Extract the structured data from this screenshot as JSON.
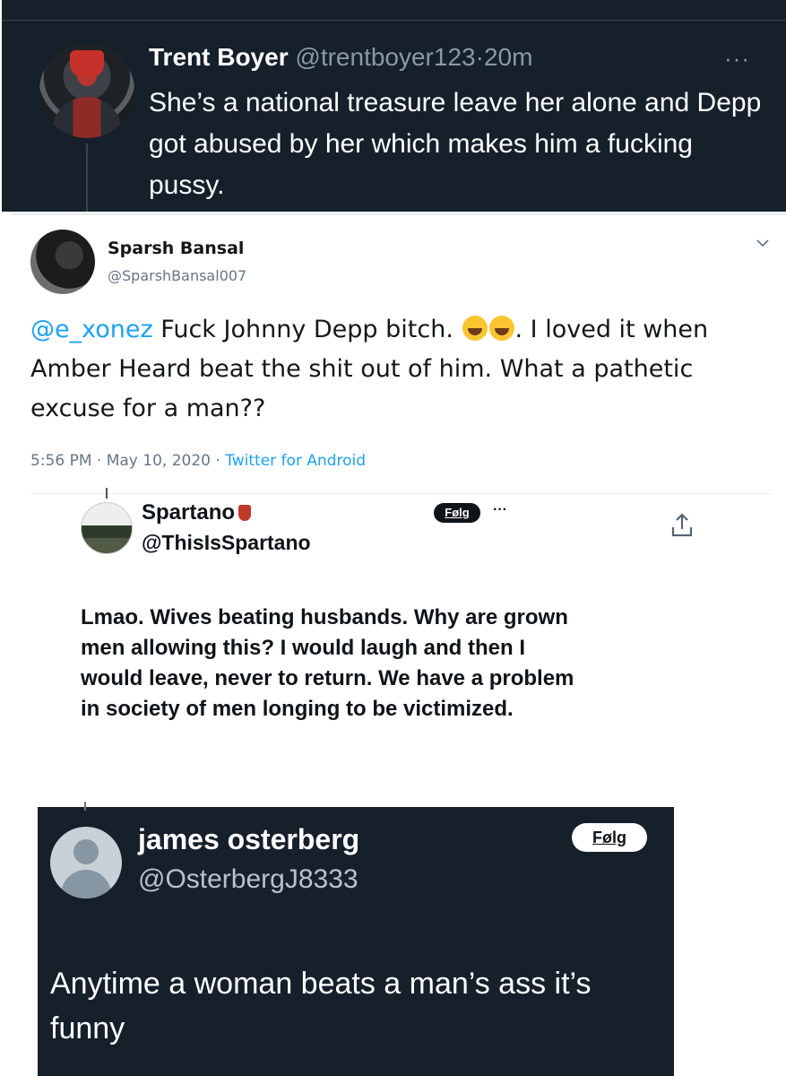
{
  "tweets": [
    {
      "name": "Trent Boyer",
      "handle": "@trentboyer123",
      "dot": "·",
      "time": "20m",
      "more": "···",
      "text": "She’s a national treasure leave her alone and Depp got abused by her which makes him a fucking pussy.",
      "colors": {
        "background": "#15202b",
        "text": "#ffffff",
        "muted": "#8b98a5"
      }
    },
    {
      "name": "Sparsh Bansal",
      "handle": "@SparshBansal007",
      "mention": "@e_xonez",
      "text_before_emoji": "Fuck Johnny Depp bitch.",
      "emojis": [
        "face-with-tears-of-joy-icon",
        "face-with-tears-of-joy-icon"
      ],
      "text_after_emoji": ". I loved it when Amber Heard beat the shit out of him. What a pathetic excuse for a man??",
      "timestamp": "5:56 PM · May 10, 2020 ·",
      "source": "Twitter for Android",
      "menu_icon": "chevron-down-icon",
      "colors": {
        "background": "#ffffff",
        "text": "#14171a",
        "link": "#1da1f2",
        "muted": "#657786"
      }
    },
    {
      "name": "Spartano",
      "handle": "@ThisIsSpartano",
      "follow_label": "Følg",
      "more": "···",
      "share_icon": "share-icon",
      "text": "Lmao. Wives beating husbands. Why are grown men allowing this? I would laugh and then I would leave, never to return. We have a problem in society of men longing to be victimized.",
      "colors": {
        "background": "#ffffff",
        "text": "#0f1419",
        "badge": "#c0392b"
      }
    },
    {
      "name": "james osterberg",
      "handle": "@OsterbergJ8333",
      "follow_label": "Følg",
      "text": "Anytime a woman beats a man’s ass it’s funny",
      "colors": {
        "background": "#15202b",
        "text": "#ffffff",
        "muted": "#b8c2cc"
      }
    }
  ]
}
